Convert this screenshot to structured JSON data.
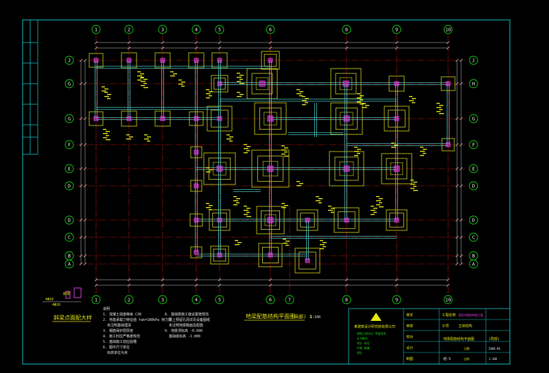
{
  "colors": {
    "background": "#000000",
    "border": "#14c8c8",
    "axis_line": "#c81414",
    "footing_outer": "#c8c814",
    "footing_inner": "#d8d840",
    "beam": "#4cc8c8",
    "column": "#e040e0",
    "grid_bubble": "#14d814",
    "dimension": "#d8d8d8",
    "text": "#e8e814",
    "note_text": "#e8e8e8"
  },
  "grid": {
    "columns": [
      "1",
      "2",
      "3",
      "4",
      "5",
      "6",
      "8",
      "9",
      "10"
    ],
    "bottom_extra": "7",
    "rows_left": [
      "J",
      "G",
      "G",
      "F",
      "E",
      "D",
      "D",
      "C",
      "B",
      "A"
    ],
    "rows_right": [
      "J",
      "H",
      "G",
      "F",
      "E",
      "D",
      "D",
      "C",
      "B",
      "A"
    ]
  },
  "drawing": {
    "title": "地梁配筋结构平面图",
    "title_scale": "(局部) 1",
    "scale_note": "1:100",
    "detail_title": "斜梁点面配大样",
    "detail_label": "斜梁",
    "label_a": "4Φ16",
    "label_b": "4Φ16",
    "notes_header": "说明",
    "notes_left": [
      "1. 混凝土强度等级 C30",
      "2. 地基承载力特征值 fak=180kPa 持力层",
      "   未注明基础埋深",
      "3. 钢筋保护层厚度",
      "4. 施工时应严格按规范",
      "5. 基础施工前应验槽",
      "6. 图中尺寸单位",
      "   标高单位为米"
    ],
    "notes_right": [
      "8. 基础梁施工缝设置按规范",
      "   梁上预留孔洞详见设备图纸",
      "   未注明地梁截面及配筋",
      "9. 地梁顶标高 -0.600",
      "   基础底标高 -1.800"
    ]
  },
  "title_block": {
    "company": "某建筑设计研究院有限公司",
    "company_info": [
      "建筑工程设计 甲级资质",
      "证书编号",
      "地址 电话",
      "传真 邮编",
      "网址"
    ],
    "project_label": "工程名称",
    "project_name": "某综合楼结构施工图",
    "item_label": "子项",
    "item_name": "主体结构",
    "drawing_name": "地梁配筋结构平面图",
    "drawing_name_suffix": "(局部)",
    "fields": [
      "审定",
      "审核",
      "校对",
      "设计",
      "制图"
    ],
    "sheet_no": "结-5",
    "date_label": "日期",
    "date": "2008.06",
    "scale_label": "比例",
    "scale": "1:100"
  }
}
